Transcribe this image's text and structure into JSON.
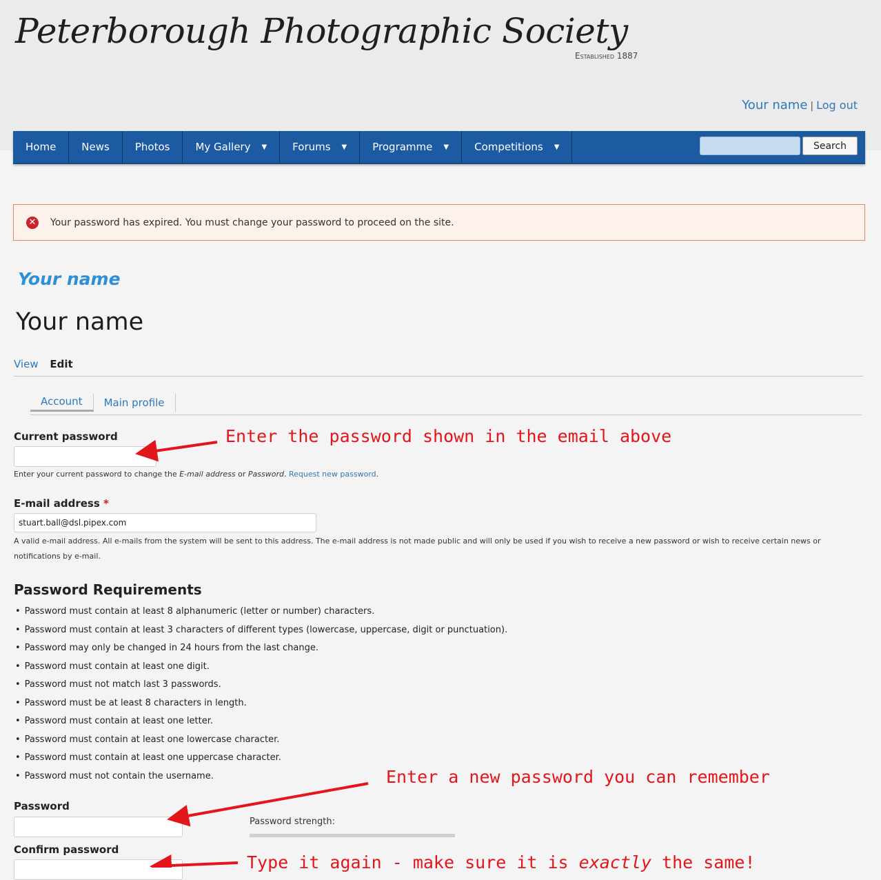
{
  "site": {
    "name": "Peterborough Photographic Society",
    "tagline": "Established 1887"
  },
  "user_links": {
    "username": "Your name",
    "separator": "|",
    "logout": "Log out"
  },
  "nav": {
    "items": [
      {
        "label": "Home",
        "dropdown": false
      },
      {
        "label": "News",
        "dropdown": false
      },
      {
        "label": "Photos",
        "dropdown": false
      },
      {
        "label": "My Gallery",
        "dropdown": true
      },
      {
        "label": "Forums",
        "dropdown": true
      },
      {
        "label": "Programme",
        "dropdown": true
      },
      {
        "label": "Competitions",
        "dropdown": true
      }
    ],
    "search_button": "Search",
    "search_value": ""
  },
  "alert": {
    "icon": "error-icon",
    "message": "Your password has expired. You must change your password to proceed on the site."
  },
  "breadcrumb_title": "Your name",
  "page_title": "Your name",
  "primary_tabs": {
    "view": "View",
    "edit": "Edit"
  },
  "secondary_tabs": {
    "account": "Account",
    "main_profile": "Main profile"
  },
  "form": {
    "current_password": {
      "label": "Current password",
      "value": "",
      "desc_pre": "Enter your current password to change the ",
      "desc_em1": "E-mail address",
      "desc_mid": " or ",
      "desc_em2": "Password",
      "desc_post": ". ",
      "desc_link": "Request new password",
      "desc_end": "."
    },
    "email": {
      "label": "E-mail address",
      "required_mark": "*",
      "value": "stuart.ball@dsl.pipex.com",
      "desc": "A valid e-mail address. All e-mails from the system will be sent to this address. The e-mail address is not made public and will only be used if you wish to receive a new password or wish to receive certain news or notifications by e-mail."
    },
    "password_requirements": {
      "title": "Password Requirements",
      "items": [
        "Password must contain at least 8 alphanumeric (letter or number) characters.",
        "Password must contain at least 3 characters of different types (lowercase, uppercase, digit or punctuation).",
        "Password may only be changed in 24 hours from the last change.",
        "Password must contain at least one digit.",
        "Password must not match last 3 passwords.",
        "Password must be at least 8 characters in length.",
        "Password must contain at least one letter.",
        "Password must contain at least one lowercase character.",
        "Password must contain at least one uppercase character.",
        "Password must not contain the username."
      ]
    },
    "password": {
      "label": "Password",
      "value": "",
      "strength_label": "Password strength:"
    },
    "confirm_password": {
      "label": "Confirm password",
      "value": ""
    }
  },
  "annotations": {
    "current_password": "Enter the password shown in the email above",
    "new_password": "Enter a new password you can remember",
    "confirm_pre": "Type it again - make sure it is ",
    "confirm_em": "exactly",
    "confirm_post": " the same!"
  },
  "colors": {
    "nav_bg": "#1c5aa1",
    "link": "#2d78b8",
    "alert_border": "#e48659",
    "annotation": "#e2161b"
  }
}
